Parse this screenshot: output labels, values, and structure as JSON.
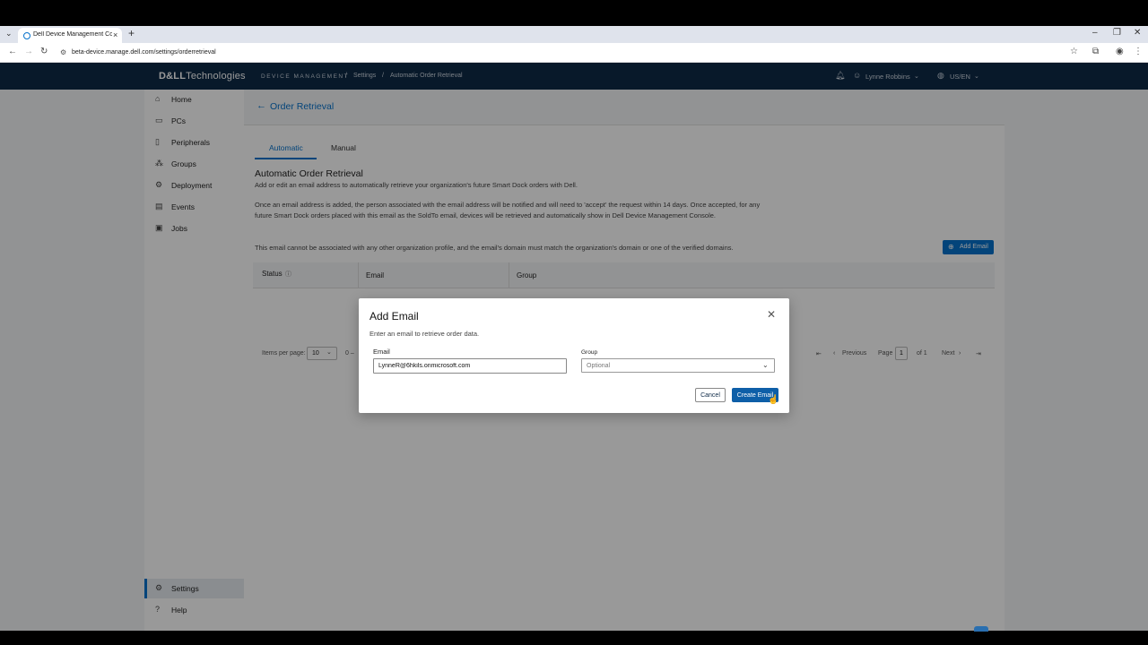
{
  "browser": {
    "tab_title": "Dell Device Management Cons",
    "tab_close": "×",
    "new_tab": "+",
    "url": "beta-device.manage.dell.com/settings/orderretrieval"
  },
  "header": {
    "logo_bold": "D&LL",
    "logo_rest": "Technologies",
    "product": "DEVICE MANAGEMENT",
    "breadcrumb_sep": "/",
    "breadcrumb_settings": "Settings",
    "breadcrumb_current": "Automatic Order Retrieval",
    "user": "Lynne Robbins",
    "locale": "US/EN"
  },
  "sidebar": {
    "items": [
      {
        "label": "Home",
        "icon": "home-icon"
      },
      {
        "label": "PCs",
        "icon": "pc-icon"
      },
      {
        "label": "Peripherals",
        "icon": "peripherals-icon"
      },
      {
        "label": "Groups",
        "icon": "groups-icon"
      },
      {
        "label": "Deployment",
        "icon": "deployment-icon"
      },
      {
        "label": "Events",
        "icon": "events-icon"
      },
      {
        "label": "Jobs",
        "icon": "jobs-icon"
      }
    ],
    "settings_label": "Settings",
    "help_label": "Help"
  },
  "main": {
    "title": "Order Retrieval",
    "tabs": [
      {
        "label": "Automatic"
      },
      {
        "label": "Manual"
      }
    ],
    "section_title": "Automatic Order Retrieval",
    "para1": "Add or edit an email address to automatically retrieve your organization's future Smart Dock orders with Dell.",
    "para2": "Once an email address is added, the person associated with the email address will be notified and will need to 'accept' the request within 14 days. Once accepted, for any future Smart Dock orders placed with this email as the SoldTo email, devices will be retrieved and automatically show in Dell Device Management Console.",
    "para3": "This email cannot be associated with any other organization profile, and the email's domain must match the organization's domain or one of the verified domains.",
    "add_email_label": "Add Email",
    "table_headers": {
      "status": "Status",
      "email": "Email",
      "group": "Group"
    },
    "pager": {
      "items_per_page_label": "Items per page:",
      "items_per_page_value": "10",
      "range": "0 –",
      "previous": "Previous",
      "page_label": "Page",
      "page_value": "1",
      "of_label": "of 1",
      "next": "Next"
    }
  },
  "modal": {
    "title": "Add Email",
    "subtitle": "Enter an email to retrieve order data.",
    "email_label": "Email",
    "email_value": "LynneR@6hkils.onmicrosoft.com",
    "group_label": "Group",
    "group_placeholder": "Optional",
    "cancel_label": "Cancel",
    "create_label": "Create Email"
  },
  "colors": {
    "accent": "#0672cb",
    "header_bg": "#0e2a47"
  }
}
